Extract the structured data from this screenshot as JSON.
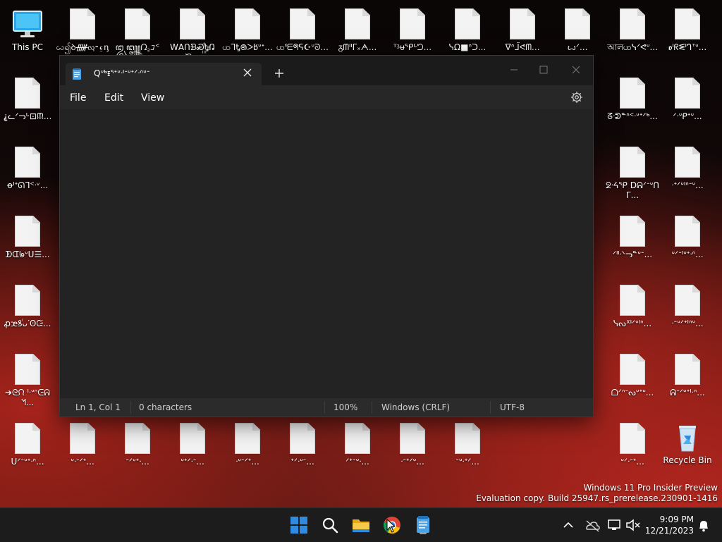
{
  "desktop": {
    "this_pc_label": "This PC",
    "recycle_bin_label": "Recycle Bin",
    "top_row": [
      "ꩬ၍ꝺᚏ̷ᦟᜓ⁃⍷ᶇu...",
      "ꦈ꧃ᘣ꜇ᝊᑉᓇ...",
      "ꓪꓮꓵᗿᏍ꙲Ꮏᕡᙟ...",
      "ꩤᒣᎿꢠᐳ𐌱ᐡᐩ...",
      "ꩤᓫᗴᖗᕋ☪ᐡᘐ...",
      "ᵹᗰᐦᒥ᙮ᗅ...",
      "ᵀᶾᵾᕿᒡᘤ...",
      "ᓭΩ■ᐢᑐ...",
      "ᐁᐢᒩᕙᗰ...",
      "ꙍᐟ...",
      "আলꩤᓭᐟᕙᐡ...",
      "ꬽᑊᖇᓬᑊᒉᐪᐡ..."
    ],
    "left_col": [
      "⸘ᓚᐟᓓᒡ⊡ᙏ...",
      "ꝋᑊᐩᘏᒣᑉᐧᵛ...",
      "ᗫᗭᖚᐡᑌ☰...",
      "ꝓꭢꝸꙶᴗᐝꙨᙍ...",
      "➔ᘓᙁ ᑊᐧᐡᐢᕮᕱᖿ..."
    ],
    "right_col_a": [
      "ᘔᐧᕲᓐᐢᑉᐧᐡᐩᐟᒃ...",
      "ᘖᐧᔦᕿ Dᕱᐟᐨᐡᑎᒥ...",
      "ᐟᐦᐧᐠᓓᓐᐡᐨ...",
      "ᓭᔓᕽᑊᐟᐡᑊᐢ...",
      "ᗝᐟᐢᐨᔓᐡᐩᐡ..."
    ],
    "right_col_b": [
      "ᐟᐧᐡᑭᐩᐡ...",
      "ᐧᐩᐟᐡᑊᐢᐨᐡ...",
      "ᐡᐟᐨᑊᐡᐩᐧᐢ...",
      "ᐧᐨᐡᐟᐩᑊᐢᐡ...",
      "ᕱᐨᐟᐡᐩᑊᐧᐢ..."
    ],
    "bottom_row": [
      "ᑌᐟᐨᐡᐩᐧᐢ...",
      "ᐡᐧᐨᐟᐩ...",
      "ᐨᐟᐡᐩᐧ...",
      "ᐡᐩᐟᐧᐨ...",
      "ᐧᐡᐨᐟᐩ...",
      "ᐩᐟᐧᐡᐨ...",
      "ᐟᐩᐨᐡᐧ...",
      "ᐧᐨᐩᐟᐡ...",
      "ᐨᐡᐧᐩᐟ...",
      "ᐡᐟᐧᐨᐩ..."
    ]
  },
  "notepad": {
    "tab_title": "Qᐡᒃᵻᕐᐩᐡᐧᑊᐨᐡᐩᐟᐧᐢᐡᐨ",
    "menu": {
      "file": "File",
      "edit": "Edit",
      "view": "View"
    },
    "status": {
      "position": "Ln 1, Col 1",
      "characters": "0 characters",
      "zoom": "100%",
      "line_endings": "Windows (CRLF)",
      "encoding": "UTF-8"
    }
  },
  "watermark": {
    "line1": "Windows 11 Pro Insider Preview",
    "line2": "Evaluation copy. Build 25947.rs_prerelease.230901-1416"
  },
  "taskbar": {
    "time": "9:09 PM",
    "date": "12/21/2023"
  },
  "colors": {
    "accent_blue": "#2f8ae0",
    "window_bg": "#202020"
  }
}
